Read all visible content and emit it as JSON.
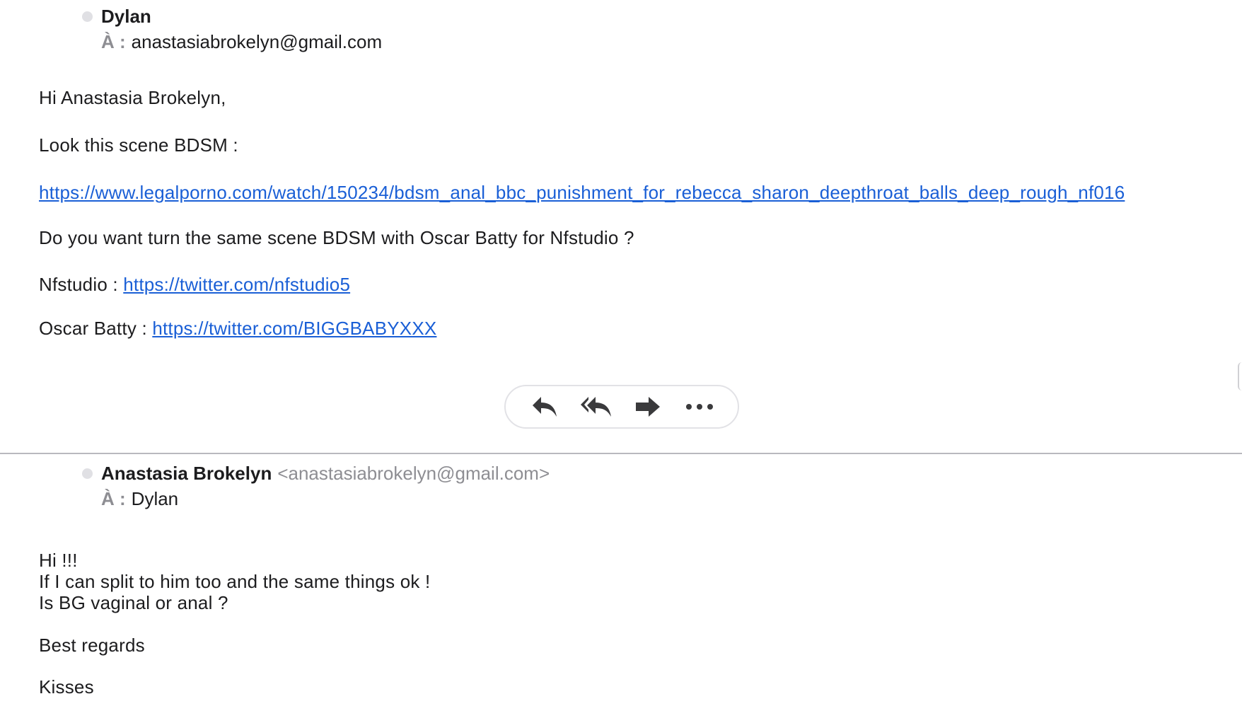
{
  "message1": {
    "sender_name": "Dylan",
    "to_label": "À :",
    "to_value": "anastasiabrokelyn@gmail.com",
    "greeting": "Hi Anastasia Brokelyn,",
    "line_look": "Look this scene BDSM :",
    "link_scene": "https://www.legalporno.com/watch/150234/bdsm_anal_bbc_punishment_for_rebecca_sharon_deepthroat_balls_deep_rough_nf016",
    "question": "Do you want turn the same scene BDSM with Oscar Batty for Nfstudio ?",
    "nfstudio_label": "Nfstudio :",
    "nfstudio_link": "https://twitter.com/nfstudio5",
    "oscar_label": "Oscar Batty :",
    "oscar_link": "https://twitter.com/BIGGBABYXXX"
  },
  "actions": {
    "reply_icon": "reply-icon",
    "reply_all_icon": "reply-all-icon",
    "forward_icon": "forward-icon",
    "more_icon": "more-icon"
  },
  "message2": {
    "sender_name": "Anastasia Brokelyn",
    "sender_email": "<anastasiabrokelyn@gmail.com>",
    "to_label": "À :",
    "to_value": "Dylan",
    "line1": "Hi !!!",
    "line2": "If I can split to him too and the same things ok !",
    "line3": "Is BG vaginal or anal ?",
    "line4": "Best regards",
    "line5": "Kisses"
  },
  "colors": {
    "link": "#1a5fd6",
    "text": "#1c1c1e",
    "secondary": "#8e8e93",
    "icon": "#3a3a3c",
    "divider": "#b9b9be"
  }
}
